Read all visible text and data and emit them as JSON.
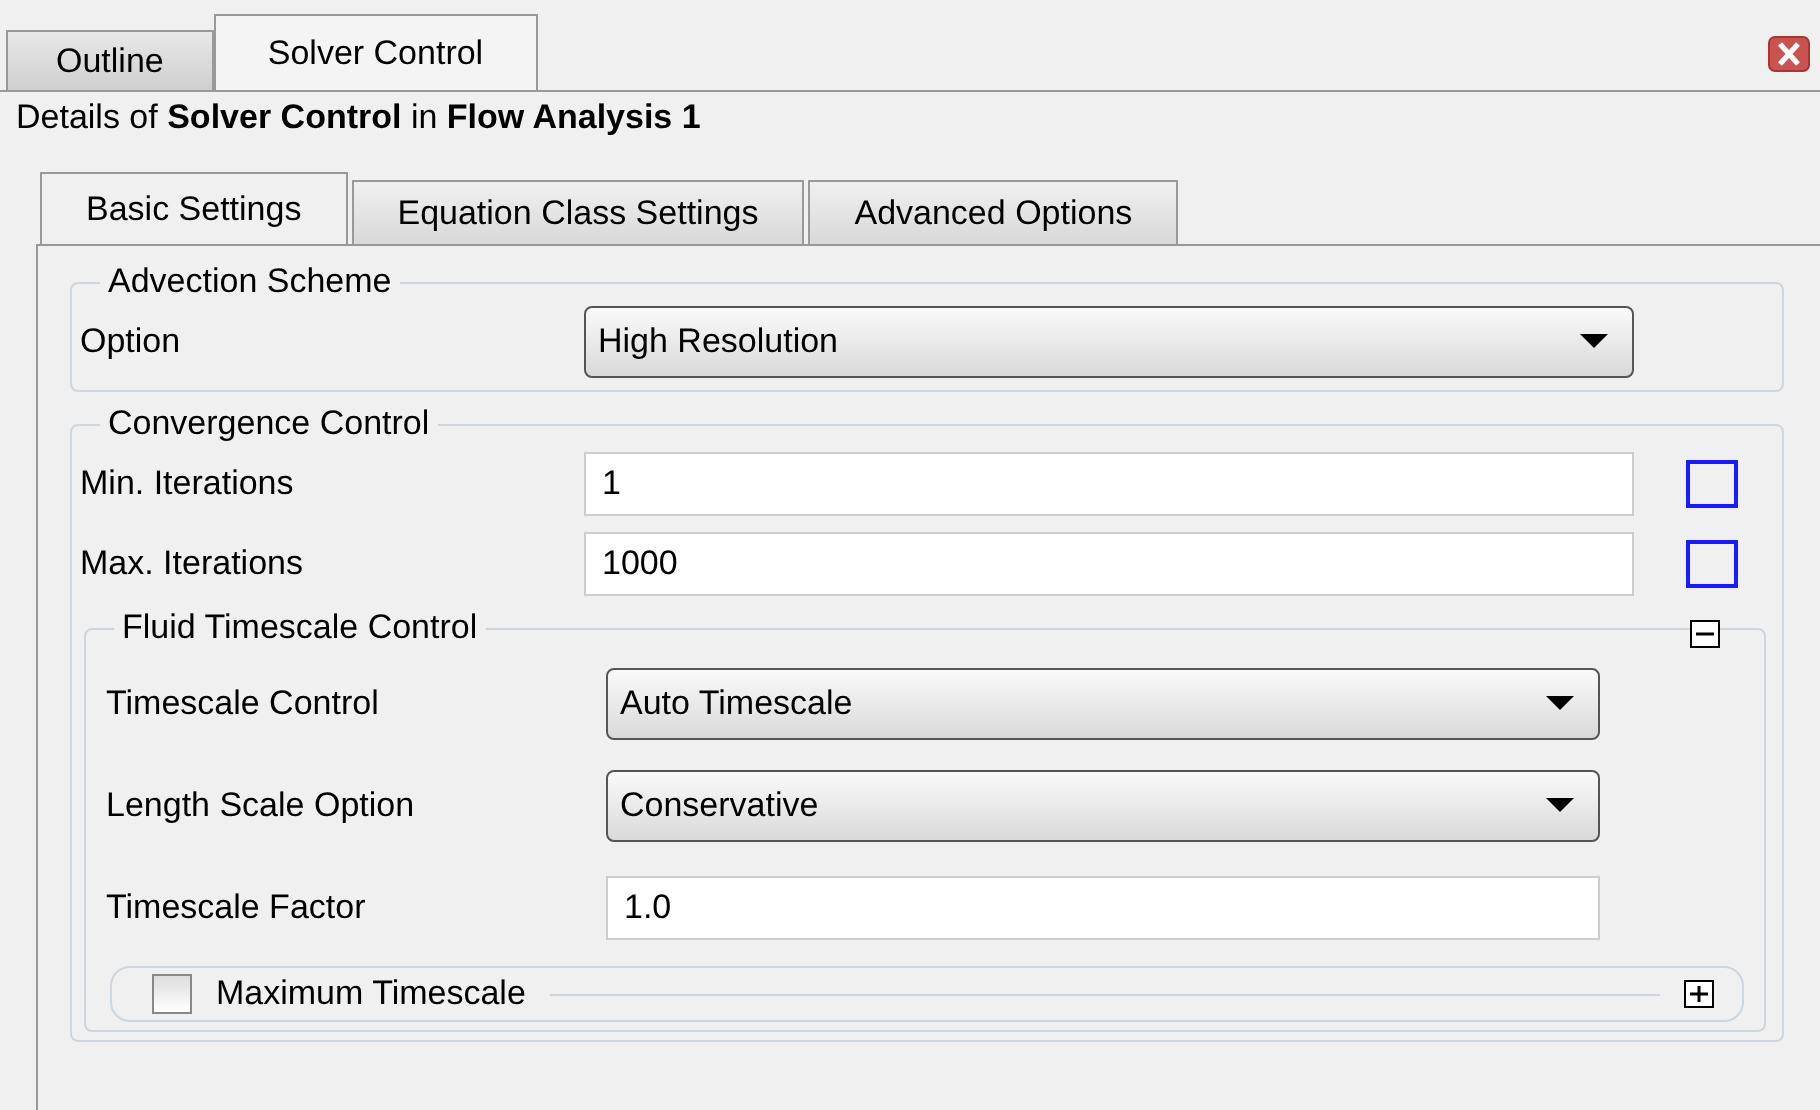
{
  "top_tabs": [
    {
      "label": "Outline",
      "selected": false
    },
    {
      "label": "Solver Control",
      "selected": true
    }
  ],
  "details": "Details of **Solver Control** in **Flow Analysis 1**",
  "tabs": [
    {
      "label": "Basic Settings",
      "selected": true
    },
    {
      "label": "Equation Class Settings",
      "selected": false
    },
    {
      "label": "Advanced Options",
      "selected": false
    }
  ],
  "groups": [
    {
      "title": "Advection Scheme",
      "rows": [
        {
          "kind": "dropdown",
          "label": "Option",
          "value": "High Resolution"
        }
      ]
    },
    {
      "title": "Convergence Control",
      "rows": [
        {
          "kind": "field",
          "label": "Min. Iterations",
          "value": "1",
          "checked": false
        },
        {
          "kind": "field",
          "label": "Max. Iterations",
          "value": "1000",
          "checked": false
        }
      ],
      "subgroup": {
        "title": "Fluid Timescale Control",
        "expanded": true,
        "rows": [
          {
            "kind": "dropdown",
            "label": "Timescale Control",
            "value": "Auto Timescale"
          },
          {
            "kind": "dropdown",
            "label": "Length Scale Option",
            "value": "Conservative"
          },
          {
            "kind": "field",
            "label": "Timescale Factor",
            "value": "1.0"
          }
        ],
        "subgroup": {
          "title": "Maximum Timescale",
          "checked": false,
          "expanded": false
        }
      }
    }
  ]
}
